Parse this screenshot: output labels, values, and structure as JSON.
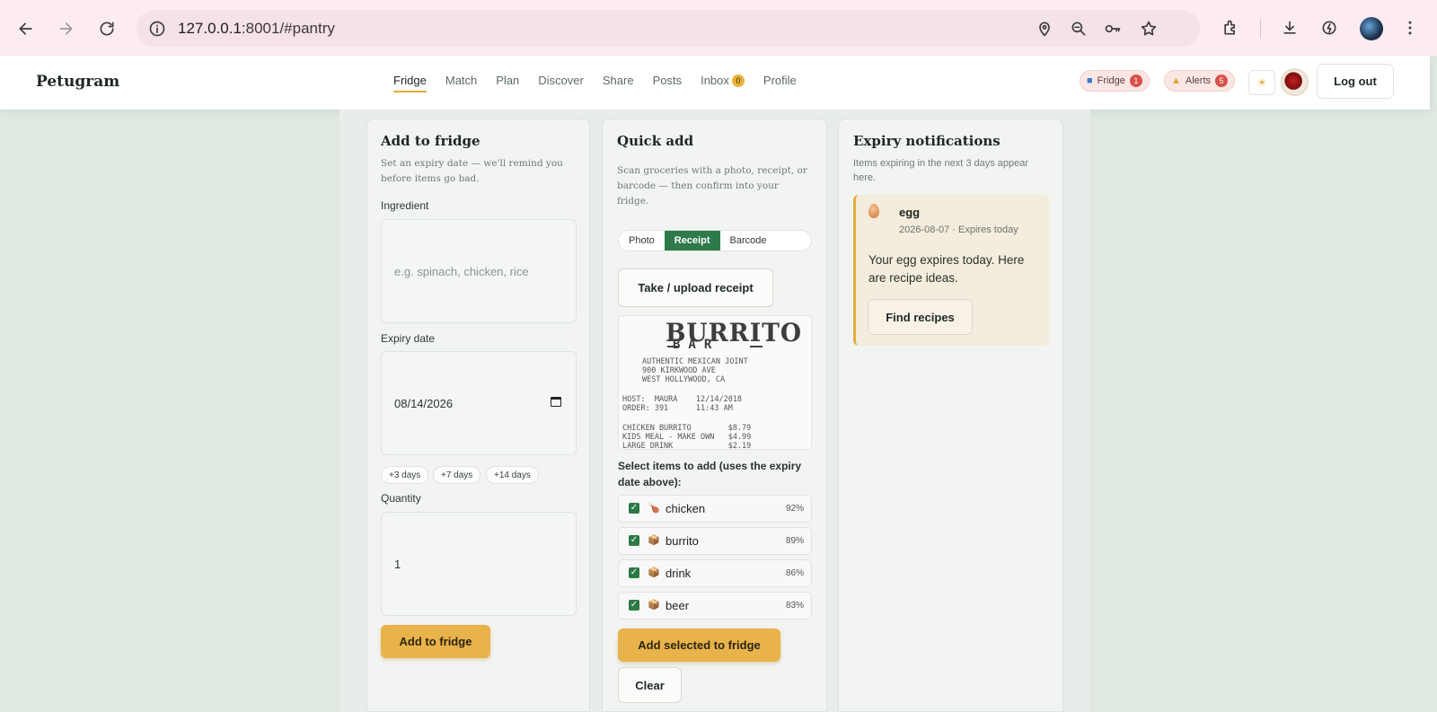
{
  "browser": {
    "url_host": "127.0.0.1",
    "url_rest": ":8001/#pantry"
  },
  "app": {
    "brand": "Petugram",
    "nav": [
      "Fridge",
      "Match",
      "Plan",
      "Discover",
      "Share",
      "Posts",
      "Inbox",
      "Profile"
    ],
    "active_nav": "Fridge",
    "inbox_count": "0",
    "fridge_pill": {
      "label": "Fridge",
      "count": "1"
    },
    "alerts_pill": {
      "label": "Alerts",
      "count": "5"
    },
    "logout_label": "Log out"
  },
  "add_card": {
    "title": "Add to fridge",
    "description": "Set an expiry date — we'll remind you before items go bad.",
    "ingredient_label": "Ingredient",
    "ingredient_placeholder": "e.g. spinach, chicken, rice",
    "expiry_label": "Expiry date",
    "expiry_value": "08/14/2026",
    "chips": [
      "+3 days",
      "+7 days",
      "+14 days"
    ],
    "quantity_label": "Quantity",
    "quantity_value": "1",
    "submit_label": "Add to fridge"
  },
  "quick_card": {
    "title": "Quick add",
    "description": "Scan groceries with a photo, receipt, or barcode — then confirm into your fridge.",
    "modes": [
      "Photo",
      "Receipt",
      "Barcode"
    ],
    "active_mode": "Receipt",
    "upload_label": "Take / upload receipt",
    "receipt": {
      "title": "BURRITO",
      "subtitle": "BAR",
      "lines": [
        "AUTHENTIC MEXICAN JOINT",
        "900 KIRKWOOD AVE",
        "WEST HOLLYWOOD, CA",
        "HOST:  MAURA    12/14/2018",
        "ORDER: 391      11:43 AM",
        "CHICKEN BURRITO        $8.79",
        "KIDS MEAL - MAKE OWN   $4.99",
        "LARGE DRINK            $2.19"
      ]
    },
    "items_title": "Select items to add (uses the expiry date above):",
    "items": [
      {
        "name": "chicken",
        "pct": "92%",
        "emoji": "🍗"
      },
      {
        "name": "burrito",
        "pct": "89%",
        "emoji": "📦"
      },
      {
        "name": "drink",
        "pct": "86%",
        "emoji": "📦"
      },
      {
        "name": "beer",
        "pct": "83%",
        "emoji": "📦"
      }
    ],
    "add_selected_label": "Add selected to fridge",
    "clear_label": "Clear"
  },
  "expiry_card": {
    "title": "Expiry notifications",
    "description": "Items expiring in the next 3 days appear here.",
    "notification": {
      "item": "egg",
      "meta": "2026-08-07 · Expires today",
      "message": "Your egg expires today. Here are recipe ideas.",
      "button": "Find recipes"
    }
  }
}
